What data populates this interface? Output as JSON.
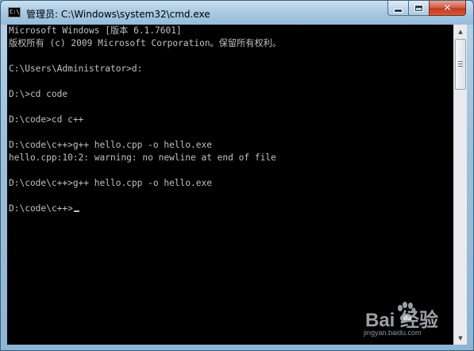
{
  "window": {
    "title": "管理员: C:\\Windows\\system32\\cmd.exe",
    "icon": "cmd-icon",
    "icon_label": "C:\\"
  },
  "console": {
    "lines": [
      "Microsoft Windows [版本 6.1.7601]",
      "版权所有 (c) 2009 Microsoft Corporation。保留所有权利。",
      "",
      "C:\\Users\\Administrator>d:",
      "",
      "D:\\>cd code",
      "",
      "D:\\code>cd c++",
      "",
      "D:\\code\\c++>g++ hello.cpp -o hello.exe",
      "hello.cpp:10:2: warning: no newline at end of file",
      "",
      "D:\\code\\c++>g++ hello.cpp -o hello.exe",
      ""
    ],
    "prompt": "D:\\code\\c++>",
    "text_color": "#c0c0c0",
    "background": "#000000"
  },
  "watermark": {
    "brand": "Bai  经验",
    "url": "jingyan.baidu.com"
  }
}
